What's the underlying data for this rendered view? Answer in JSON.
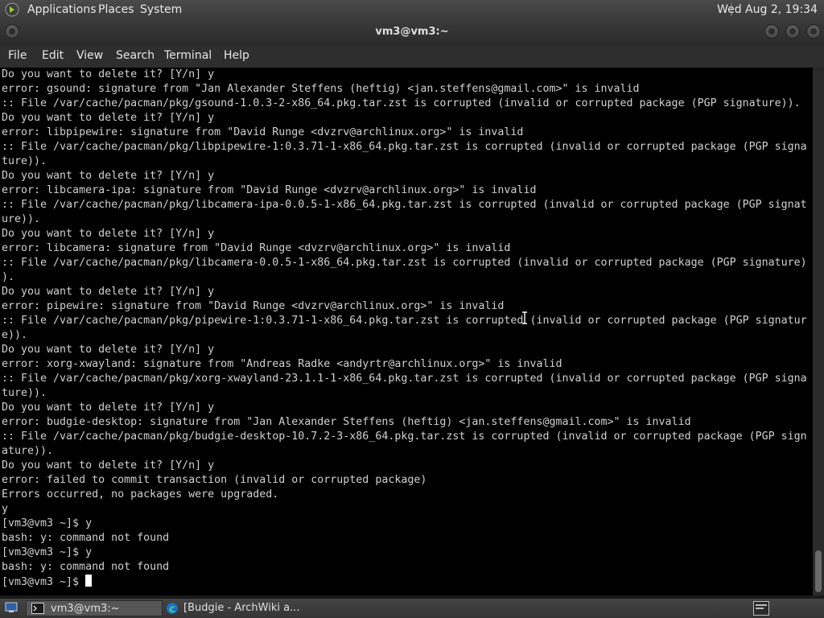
{
  "top_panel": {
    "applications": "Applications",
    "places": "Places",
    "system": "System",
    "clock": "Wed Aug  2, 19:34"
  },
  "window": {
    "title": "vm3@vm3:~"
  },
  "menubar": {
    "file": "File",
    "edit": "Edit",
    "view": "View",
    "search": "Search",
    "terminal": "Terminal",
    "help": "Help"
  },
  "terminal": {
    "output": "Do you want to delete it? [Y/n] y\nerror: gsound: signature from \"Jan Alexander Steffens (heftig) <jan.steffens@gmail.com>\" is invalid\n:: File /var/cache/pacman/pkg/gsound-1.0.3-2-x86_64.pkg.tar.zst is corrupted (invalid or corrupted package (PGP signature)).\nDo you want to delete it? [Y/n] y\nerror: libpipewire: signature from \"David Runge <dvzrv@archlinux.org>\" is invalid\n:: File /var/cache/pacman/pkg/libpipewire-1:0.3.71-1-x86_64.pkg.tar.zst is corrupted (invalid or corrupted package (PGP signa\nture)).\nDo you want to delete it? [Y/n] y\nerror: libcamera-ipa: signature from \"David Runge <dvzrv@archlinux.org>\" is invalid\n:: File /var/cache/pacman/pkg/libcamera-ipa-0.0.5-1-x86_64.pkg.tar.zst is corrupted (invalid or corrupted package (PGP signat\nure)).\nDo you want to delete it? [Y/n] y\nerror: libcamera: signature from \"David Runge <dvzrv@archlinux.org>\" is invalid\n:: File /var/cache/pacman/pkg/libcamera-0.0.5-1-x86_64.pkg.tar.zst is corrupted (invalid or corrupted package (PGP signature)\n).\nDo you want to delete it? [Y/n] y\nerror: pipewire: signature from \"David Runge <dvzrv@archlinux.org>\" is invalid\n:: File /var/cache/pacman/pkg/pipewire-1:0.3.71-1-x86_64.pkg.tar.zst is corrupted (invalid or corrupted package (PGP signatur\ne)).\nDo you want to delete it? [Y/n] y\nerror: xorg-xwayland: signature from \"Andreas Radke <andyrtr@archlinux.org>\" is invalid\n:: File /var/cache/pacman/pkg/xorg-xwayland-23.1.1-1-x86_64.pkg.tar.zst is corrupted (invalid or corrupted package (PGP signa\nture)).\nDo you want to delete it? [Y/n] y\nerror: budgie-desktop: signature from \"Jan Alexander Steffens (heftig) <jan.steffens@gmail.com>\" is invalid\n:: File /var/cache/pacman/pkg/budgie-desktop-10.7.2-3-x86_64.pkg.tar.zst is corrupted (invalid or corrupted package (PGP sign\nature)).\nDo you want to delete it? [Y/n] y\nerror: failed to commit transaction (invalid or corrupted package)\nErrors occurred, no packages were upgraded.\ny\n[vm3@vm3 ~]$ y\nbash: y: command not found\n[vm3@vm3 ~]$ y\nbash: y: command not found\n",
    "prompt": "[vm3@vm3 ~]$ "
  },
  "taskbar": {
    "terminal_task": "vm3@vm3:~",
    "browser_task": "[Budgie - ArchWiki a..."
  },
  "colors": {
    "terminal_bg": "#000000",
    "terminal_fg": "#d0d0d0",
    "panel_bg": "#3a3a3a"
  }
}
